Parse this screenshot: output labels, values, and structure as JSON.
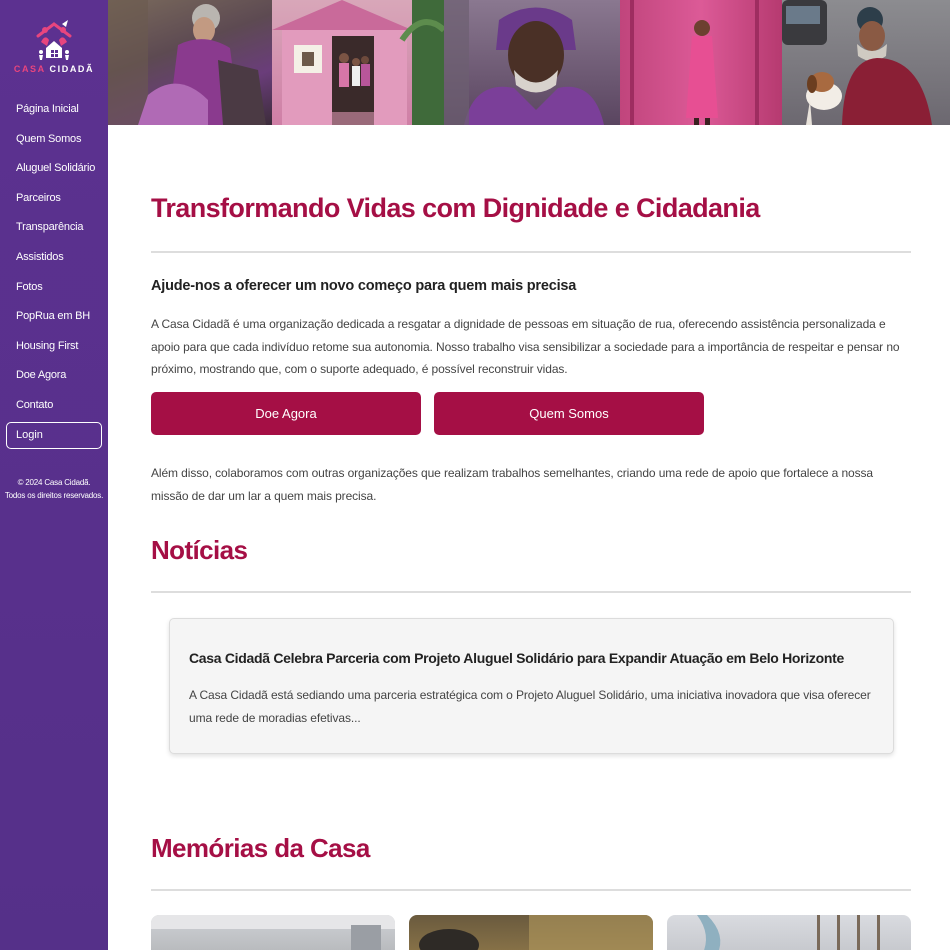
{
  "brand": {
    "name_part1": "CASA",
    "name_part2": "CIDADÃ"
  },
  "nav": {
    "items": [
      "Página Inicial",
      "Quem Somos",
      "Aluguel Solidário",
      "Parceiros",
      "Transparência",
      "Assistidos",
      "Fotos",
      "PopRua em BH",
      "Housing First",
      "Doe Agora",
      "Contato"
    ],
    "login": "Login"
  },
  "footer": {
    "line1": "© 2024 Casa Cidadã.",
    "line2": "Todos os direitos reservados."
  },
  "hero": {
    "title": "Transformando Vidas com Dignidade e Cidadania",
    "subtitle": "Ajude-nos a oferecer um novo começo para quem mais precisa",
    "intro": "A Casa Cidadã é uma organização dedicada a resgatar a dignidade de pessoas em situação de rua, oferecendo assistência personalizada e apoio para que cada indivíduo retome sua autonomia. Nosso trabalho visa sensibilizar a sociedade para a importância de respeitar e pensar no próximo, mostrando que, com o suporte adequado, é possível reconstruir vidas.",
    "donate_button": "Doe Agora",
    "about_button": "Quem Somos",
    "extra": "Além disso, colaboramos com outras organizações que realizam trabalhos semelhantes, criando uma rede de apoio que fortalece a nossa missão de dar um lar a quem mais precisa."
  },
  "news": {
    "heading": "Notícias",
    "items": [
      {
        "title": "Casa Cidadã Celebra Parceria com Projeto Aluguel Solidário para Expandir Atuação em Belo Horizonte",
        "excerpt": "A Casa Cidadã está sediando uma parceria estratégica com o Projeto Aluguel Solidário, uma iniciativa inovadora que visa oferecer uma rede de moradias efetivas..."
      }
    ]
  },
  "memories": {
    "heading": "Memórias da Casa"
  },
  "colors": {
    "sidebar": "#5b2f91",
    "accent": "#a50f45",
    "logo_pink": "#e8457e"
  }
}
